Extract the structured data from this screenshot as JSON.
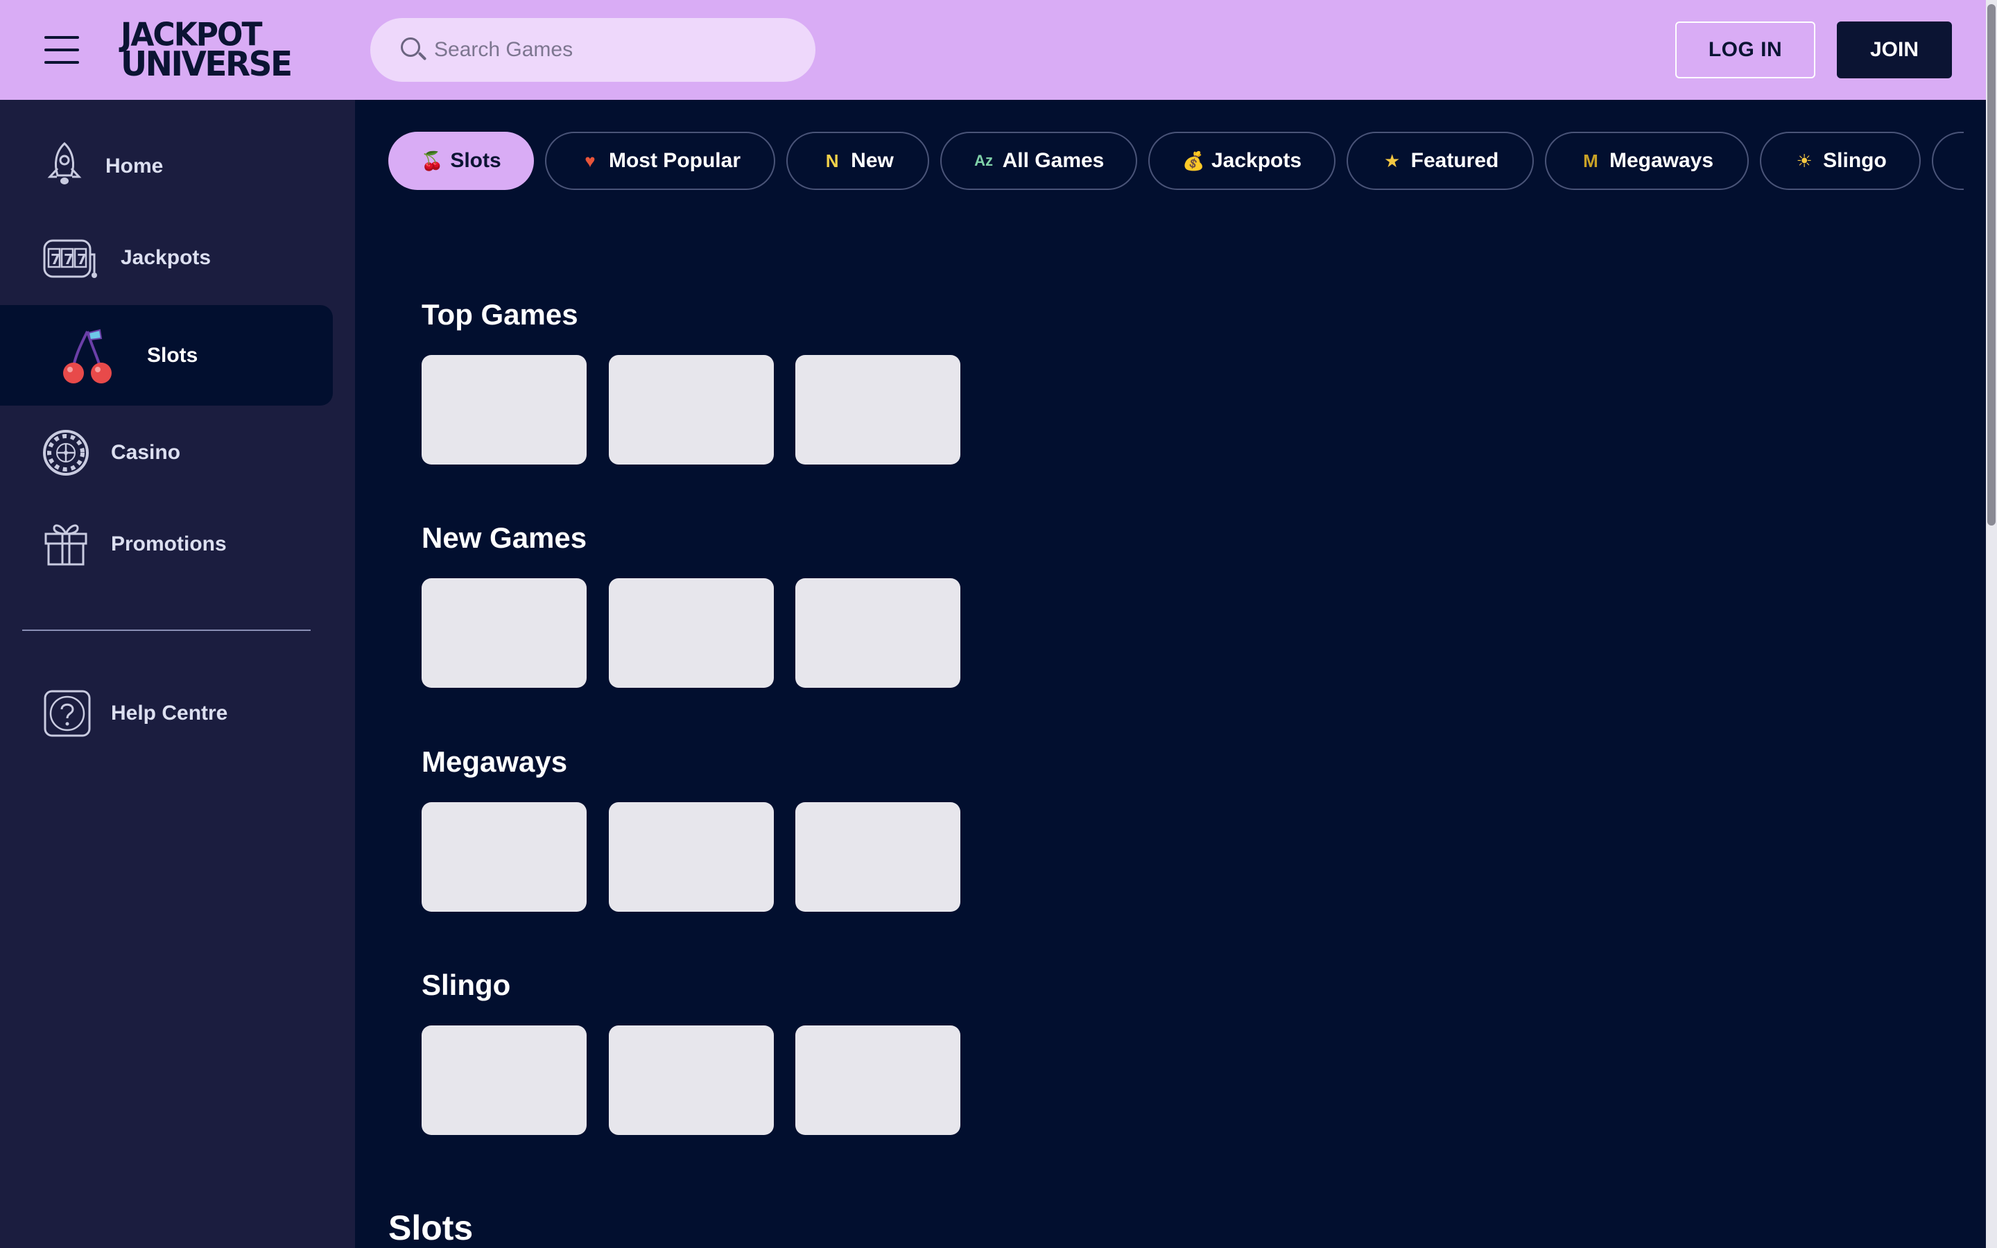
{
  "header": {
    "logo_line1": "JACKPOT",
    "logo_line2": "UNIVERSE",
    "search_placeholder": "Search Games",
    "login_label": "LOG IN",
    "join_label": "JOIN"
  },
  "sidebar": {
    "items": [
      {
        "label": "Home",
        "icon": "rocket-icon"
      },
      {
        "label": "Jackpots",
        "icon": "slot-machine-icon"
      },
      {
        "label": "Slots",
        "icon": "cherries-icon",
        "active": true
      },
      {
        "label": "Casino",
        "icon": "roulette-icon"
      },
      {
        "label": "Promotions",
        "icon": "gift-icon"
      }
    ],
    "help": {
      "label": "Help Centre",
      "icon": "help-icon"
    }
  },
  "tabs": [
    {
      "label": "Slots",
      "icon": "cherries-icon",
      "glyph": "🍒",
      "active": true
    },
    {
      "label": "Most Popular",
      "icon": "heart-icon",
      "glyph": "♥"
    },
    {
      "label": "New",
      "icon": "new-n-icon",
      "glyph": "N"
    },
    {
      "label": "All Games",
      "icon": "az-icon",
      "glyph": "Az"
    },
    {
      "label": "Jackpots",
      "icon": "money-bag-icon",
      "glyph": "💰"
    },
    {
      "label": "Featured",
      "icon": "star-icon",
      "glyph": "★"
    },
    {
      "label": "Megaways",
      "icon": "megaways-m-icon",
      "glyph": "M"
    },
    {
      "label": "Slingo",
      "icon": "sun-icon",
      "glyph": "☀"
    }
  ],
  "sections": [
    {
      "title": "Top Games",
      "tiles": 3
    },
    {
      "title": "New Games",
      "tiles": 3
    },
    {
      "title": "Megaways",
      "tiles": 3
    },
    {
      "title": "Slingo",
      "tiles": 3
    }
  ],
  "bottom_title": "Slots",
  "colors": {
    "header_bg": "#d9acf5",
    "page_bg": "#020f2f",
    "sidebar_bg": "#1b1d3f",
    "tile_bg": "#e7e6ec",
    "accent_dark": "#0b1433"
  }
}
